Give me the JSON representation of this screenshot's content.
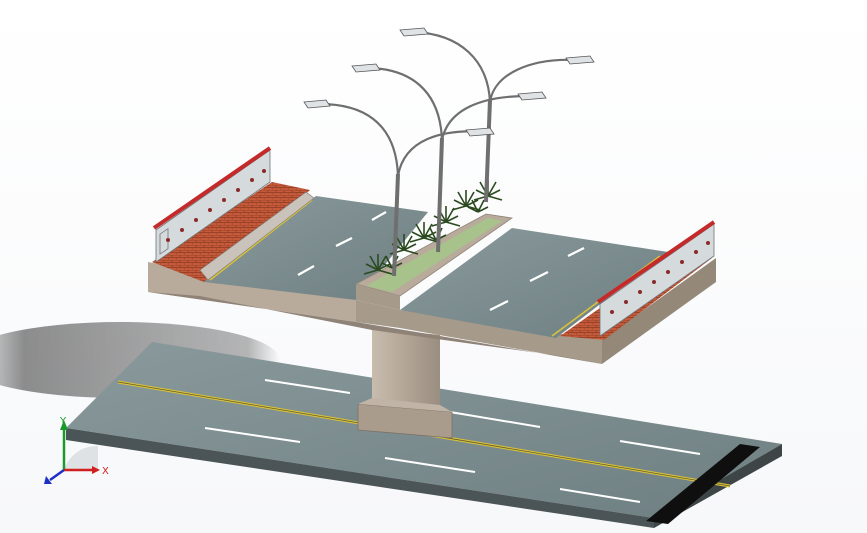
{
  "colors": {
    "background": "#ffffff",
    "road_asphalt": "#7f8f92",
    "road_edge": "#4b5456",
    "lane_marking": "#ffffff",
    "center_line": "#d9c23a",
    "concrete": "#b5a89a",
    "concrete_dark": "#8f8378",
    "sidewalk_brick": "#c45a3a",
    "railing_top": "#c42a2a",
    "railing_panel": "#c9d0d4",
    "median_grass": "#a7c28a",
    "palm_leaf": "#2c4a20",
    "lamp_pole": "#6f6f6f",
    "axis_x": "#d01f1f",
    "axis_y": "#1a9a2a",
    "axis_z": "#1e2fc8"
  },
  "icons": {
    "triad": "coordinate-triad-icon"
  },
  "triad": {
    "x_label": "X",
    "y_label": "Y"
  }
}
